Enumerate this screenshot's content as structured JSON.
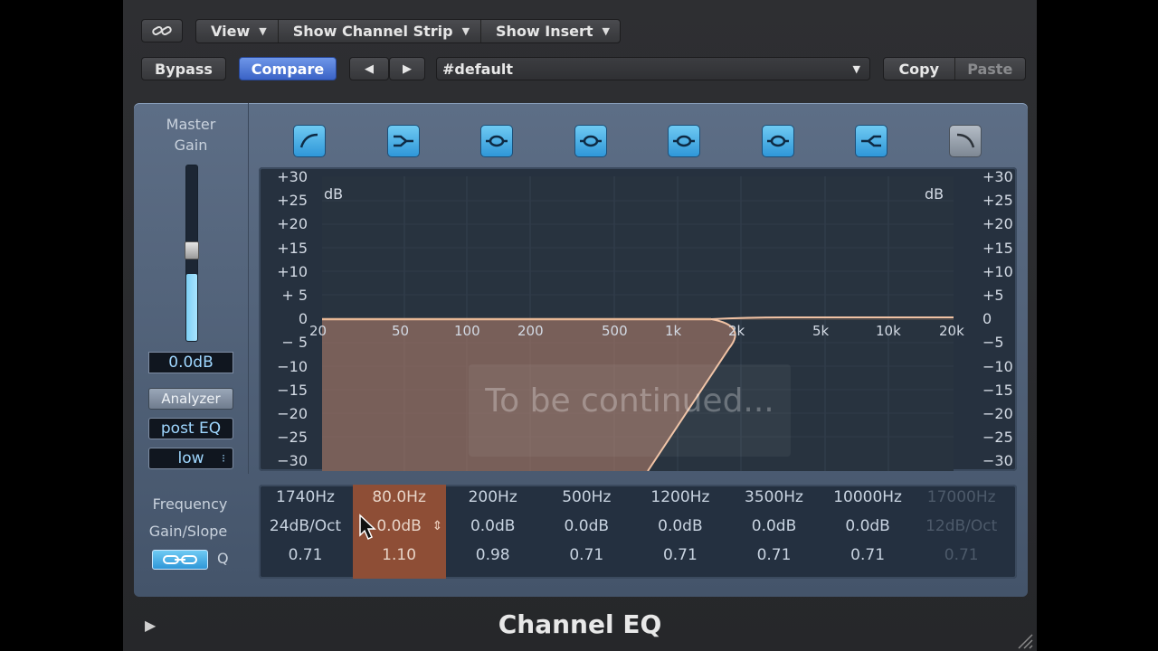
{
  "toolbar": {
    "view": "View",
    "show_channel_strip": "Show Channel Strip",
    "show_insert": "Show Insert",
    "bypass": "Bypass",
    "compare": "Compare",
    "prev_arrow": "◀",
    "next_arrow": "▶",
    "preset": "#default",
    "copy": "Copy",
    "paste": "Paste"
  },
  "left": {
    "master_gain_line1": "Master",
    "master_gain_line2": "Gain",
    "master_gain_value": "0.0dB",
    "master_gain_level": 0.38,
    "analyzer": "Analyzer",
    "post_eq": "post EQ",
    "resolution": "low"
  },
  "graph": {
    "db_unit_left": "dB",
    "db_unit_right": "dB",
    "db_labels_left": [
      "+30",
      "+25",
      "+20",
      "+15",
      "+10",
      "+ 5",
      "0",
      "− 5",
      "−10",
      "−15",
      "−20",
      "−25",
      "−30"
    ],
    "db_labels_right": [
      "+30",
      "+25",
      "+20",
      "+15",
      "+10",
      "+5",
      "0",
      "−5",
      "−10",
      "−15",
      "−20",
      "−25",
      "−30"
    ],
    "freq_labels": [
      "20",
      "50",
      "100",
      "200",
      "500",
      "1k",
      "2k",
      "5k",
      "10k",
      "20k"
    ],
    "overlay_text": "To be continued..."
  },
  "params": {
    "row_labels": {
      "frequency": "Frequency",
      "gain_slope": "Gain/Slope",
      "q": "Q"
    },
    "bands": [
      {
        "freq": "1740Hz",
        "gain": "24dB/Oct",
        "q": "0.71",
        "state": "on"
      },
      {
        "freq": "80.0Hz",
        "gain": "0.0dB",
        "q": "1.10",
        "state": "selected"
      },
      {
        "freq": "200Hz",
        "gain": "0.0dB",
        "q": "0.98",
        "state": "on"
      },
      {
        "freq": "500Hz",
        "gain": "0.0dB",
        "q": "0.71",
        "state": "on"
      },
      {
        "freq": "1200Hz",
        "gain": "0.0dB",
        "q": "0.71",
        "state": "on"
      },
      {
        "freq": "3500Hz",
        "gain": "0.0dB",
        "q": "0.71",
        "state": "on"
      },
      {
        "freq": "10000Hz",
        "gain": "0.0dB",
        "q": "0.71",
        "state": "on"
      },
      {
        "freq": "17000Hz",
        "gain": "12dB/Oct",
        "q": "0.71",
        "state": "off"
      }
    ]
  },
  "footer": {
    "title": "Channel EQ",
    "play": "▶"
  },
  "icons": [
    "link-icon",
    "lowcut-icon",
    "lowshelf-icon",
    "bell-icon",
    "highshelf-icon",
    "highcut-icon",
    "q-link-icon",
    "stepper-icon",
    "cursor-icon",
    "play-icon",
    "resize-grip-icon"
  ],
  "colors": {
    "accent": "#3a63c6",
    "band_on": "#2f97d8",
    "curve": "#e8b896",
    "selected_band": "#a0553a"
  }
}
